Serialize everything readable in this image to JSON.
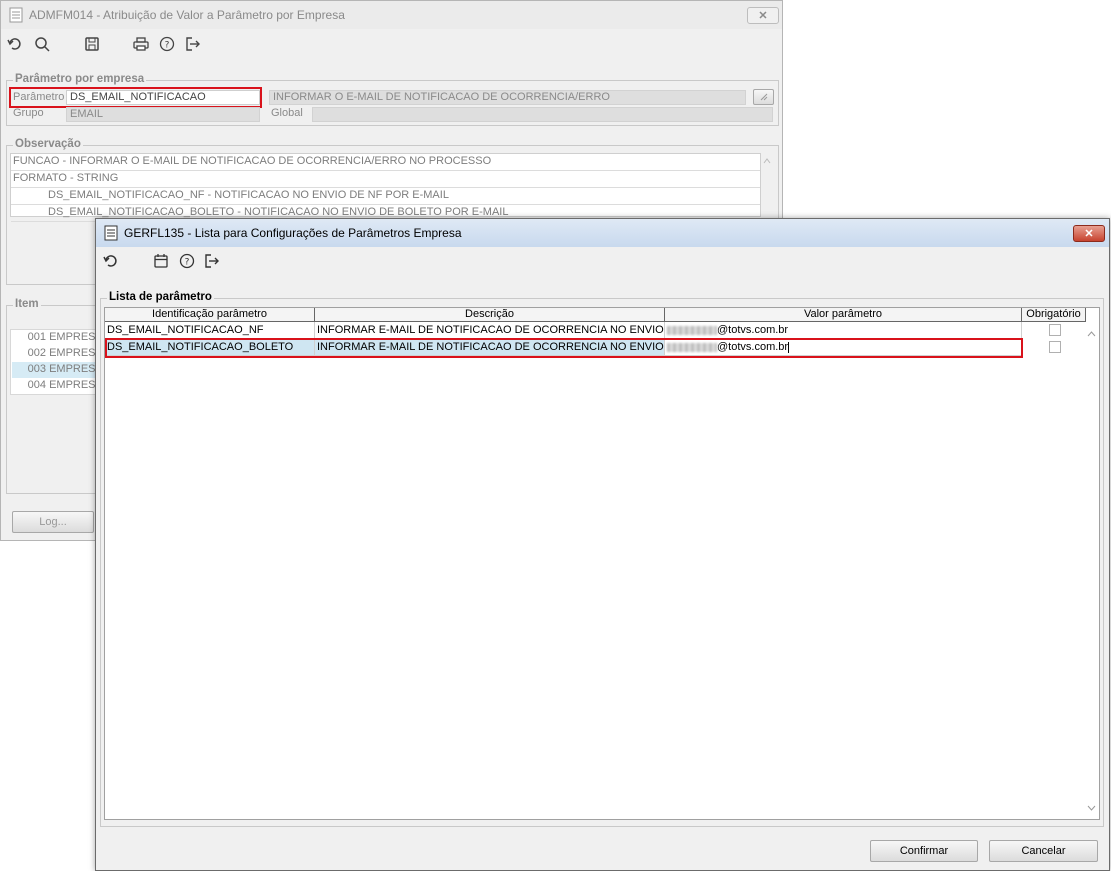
{
  "bg_window": {
    "title": "ADMFM014 - Atribuição de Valor a Parâmetro por Empresa",
    "close_glyph": "✕",
    "toolbar_icons": [
      "undo-icon",
      "search-icon",
      "save-icon",
      "print-icon",
      "help-icon",
      "exit-icon"
    ],
    "param_group": {
      "legend": "Parâmetro por empresa",
      "parametro_label": "Parâmetro",
      "parametro_value": "DS_EMAIL_NOTIFICACAO",
      "description_value": "INFORMAR O E-MAIL DE NOTIFICACAO DE OCORRENCIA/ERRO",
      "grupo_label": "Grupo",
      "grupo_value": "EMAIL",
      "global_label": "Global",
      "global_value": ""
    },
    "obs_group": {
      "legend": "Observação",
      "lines": [
        "FUNCAO - INFORMAR O E-MAIL DE NOTIFICACAO DE OCORRENCIA/ERRO NO PROCESSO",
        "FORMATO - STRING",
        "DS_EMAIL_NOTIFICACAO_NF - NOTIFICACAO NO ENVIO DE NF POR E-MAIL",
        "DS_EMAIL_NOTIFICACAO_BOLETO - NOTIFICACAO NO ENVIO DE BOLETO POR E-MAIL"
      ]
    },
    "item_group": {
      "legend": "Item",
      "rows": [
        {
          "num": "001",
          "name": "EMPRESA"
        },
        {
          "num": "002",
          "name": "EMPRESA"
        },
        {
          "num": "003",
          "name": "EMPRESA"
        },
        {
          "num": "004",
          "name": "EMPRESA"
        }
      ]
    },
    "log_button": "Log..."
  },
  "dialog": {
    "title": "GERFL135 - Lista para Configurações de Parâmetros Empresa",
    "close_glyph": "✕",
    "toolbar_icons": [
      "undo-icon",
      "calendar-icon",
      "help-icon",
      "exit-icon"
    ],
    "group_legend": "Lista de parâmetro",
    "columns": [
      "Identificação parâmetro",
      "Descrição",
      "Valor parâmetro",
      "Obrigatório"
    ],
    "rows": [
      {
        "id": "DS_EMAIL_NOTIFICACAO_NF",
        "descricao": "INFORMAR E-MAIL DE NOTIFICACAO DE OCORRENCIA NO ENVIO DE NF",
        "valor": "@totvs.com.br",
        "obrigatorio": false
      },
      {
        "id": "DS_EMAIL_NOTIFICACAO_BOLETO",
        "descricao": "INFORMAR E-MAIL DE NOTIFICACAO DE OCORRENCIA NO ENVIO DE BO",
        "valor": "@totvs.com.br",
        "obrigatorio": false
      }
    ],
    "confirm_button": "Confirmar",
    "cancel_button": "Cancelar"
  },
  "colors": {
    "highlight_border": "#d9121b",
    "selected_row": "#cfe6f2",
    "dialog_title_bg": "#c8d9ee"
  }
}
